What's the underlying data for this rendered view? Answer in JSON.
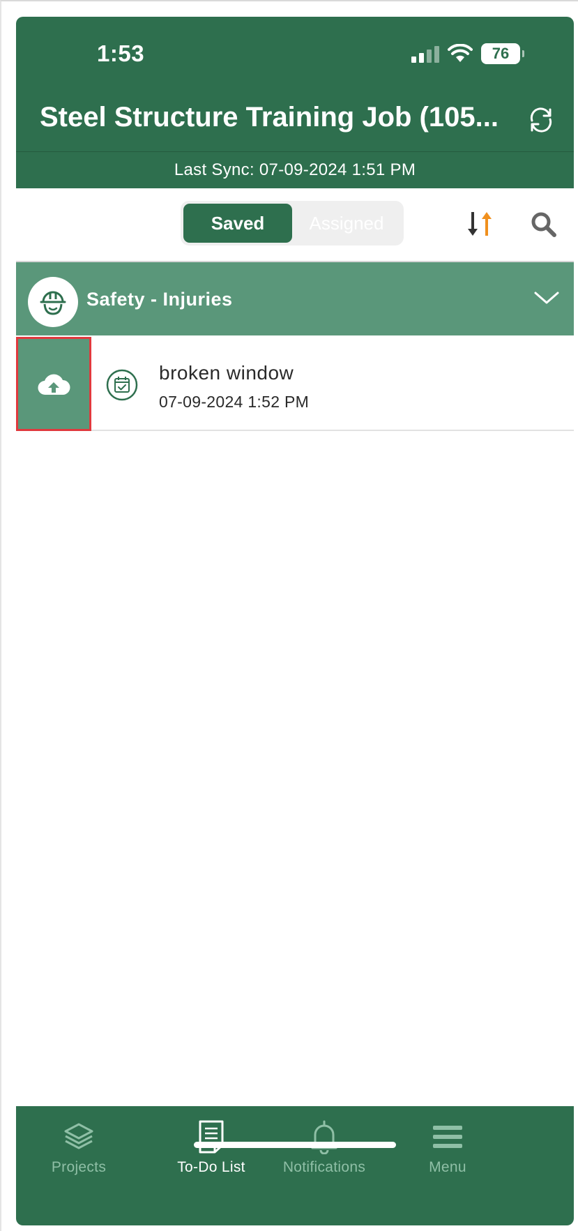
{
  "status_bar": {
    "time": "1:53",
    "battery": "76"
  },
  "header": {
    "title": "Steel Structure Training Job (105...",
    "last_sync": "Last Sync: 07-09-2024 1:51 PM"
  },
  "toolbar": {
    "tabs": [
      {
        "label": "Saved",
        "active": true
      },
      {
        "label": "Assigned",
        "active": false
      }
    ]
  },
  "category": {
    "label": "Safety - Injuries",
    "icon": "hard-hat-worker-icon"
  },
  "items": [
    {
      "title": "broken window",
      "date": "07-09-2024 1:52 PM",
      "icon": "calendar-check-icon",
      "action_icon": "cloud-upload-icon"
    }
  ],
  "bottom_nav": [
    {
      "label": "Projects",
      "icon": "layers-icon",
      "active": false
    },
    {
      "label": "To-Do List",
      "icon": "document-icon",
      "active": true
    },
    {
      "label": "Notifications",
      "icon": "bell-icon",
      "active": false
    },
    {
      "label": "Menu",
      "icon": "hamburger-icon",
      "active": false
    }
  ],
  "colors": {
    "primary": "#2e6f4e",
    "secondary": "#5a977a",
    "sort_accent": "#f0901e",
    "highlight": "#e0393e"
  }
}
